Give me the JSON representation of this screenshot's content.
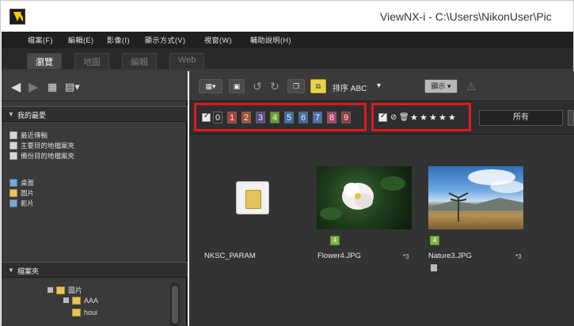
{
  "window": {
    "title": "ViewNX-i - C:\\Users\\NikonUser\\Pic"
  },
  "menu": [
    "檔案(F)",
    "編輯(E)",
    "影像(I)",
    "顯示方式(V)",
    "視窗(W)",
    "輔助說明(H)"
  ],
  "tabs": [
    {
      "label": "瀏覽",
      "active": true
    },
    {
      "label": "地圖",
      "active": false
    },
    {
      "label": "編輯",
      "active": false
    },
    {
      "label": "Web",
      "active": false
    }
  ],
  "left_panel": {
    "my_items": {
      "title": "我的最愛",
      "items": [
        "最近傳輸",
        "主要目的地檔案夾",
        "備份目的地檔案夾",
        "桌面",
        "圖片",
        "影片"
      ]
    },
    "folders": {
      "title": "檔案夾",
      "tree": [
        "圖片",
        "AAA",
        "houi"
      ]
    }
  },
  "toolbar": {
    "sort_label": "排序 ABC",
    "view_button": "顯示"
  },
  "filter": {
    "labels": [
      "0",
      "1",
      "2",
      "3",
      "4",
      "5",
      "6",
      "7",
      "8",
      "9"
    ],
    "label_colors": [
      "#2e2e2e",
      "#b23a3a",
      "#a5502e",
      "#5a4a8a",
      "#6aa02a",
      "#3a6fb0",
      "#3d6aa8",
      "#4a72b8",
      "#b04070",
      "#9a3a3a"
    ],
    "stars": [
      "★",
      "★",
      "★",
      "★",
      "★"
    ],
    "all_text": "所有"
  },
  "thumbnails": [
    {
      "name": "NKSC_PARAM",
      "size": "",
      "flag": ""
    },
    {
      "name": "Flower4.JPG",
      "size": "*3",
      "flag": "4"
    },
    {
      "name": "Nature3.JPG",
      "size": "*3",
      "flag": "4"
    }
  ],
  "colors": {
    "accent_red": "#e0191b",
    "panel_dark": "#333333",
    "highlight_yellow": "#e8d34a"
  }
}
